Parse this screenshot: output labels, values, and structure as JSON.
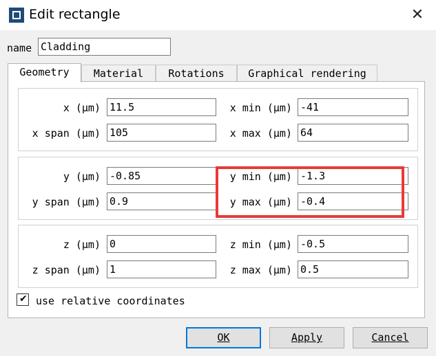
{
  "window": {
    "title": "Edit rectangle",
    "close_glyph": "✕"
  },
  "name_field": {
    "label": "name",
    "value": "Cladding"
  },
  "tabs": [
    {
      "label": "Geometry",
      "active": true
    },
    {
      "label": "Material",
      "active": false
    },
    {
      "label": "Rotations",
      "active": false
    },
    {
      "label": "Graphical rendering",
      "active": false
    }
  ],
  "geometry": {
    "x": {
      "label": "x (μm)",
      "value": "11.5"
    },
    "x_min": {
      "label": "x min (μm)",
      "value": "-41"
    },
    "x_span": {
      "label": "x span (μm)",
      "value": "105"
    },
    "x_max": {
      "label": "x max (μm)",
      "value": "64"
    },
    "y": {
      "label": "y (μm)",
      "value": "-0.85"
    },
    "y_min": {
      "label": "y min (μm)",
      "value": "-1.3"
    },
    "y_span": {
      "label": "y span (μm)",
      "value": "0.9"
    },
    "y_max": {
      "label": "y max (μm)",
      "value": "-0.4"
    },
    "z": {
      "label": "z (μm)",
      "value": "0"
    },
    "z_min": {
      "label": "z min (μm)",
      "value": "-0.5"
    },
    "z_span": {
      "label": "z span (μm)",
      "value": "1"
    },
    "z_max": {
      "label": "z max (μm)",
      "value": "0.5"
    }
  },
  "relative_coords": {
    "label": "use relative coordinates",
    "checked": true,
    "check_glyph": "✔"
  },
  "buttons": {
    "ok": {
      "label": "OK"
    },
    "apply": {
      "label": "Apply"
    },
    "cancel": {
      "label": "Cancel"
    }
  },
  "colors": {
    "highlight": "#e83a3a",
    "default_button_border": "#0078d7",
    "app_icon": "#1f4a7a"
  }
}
